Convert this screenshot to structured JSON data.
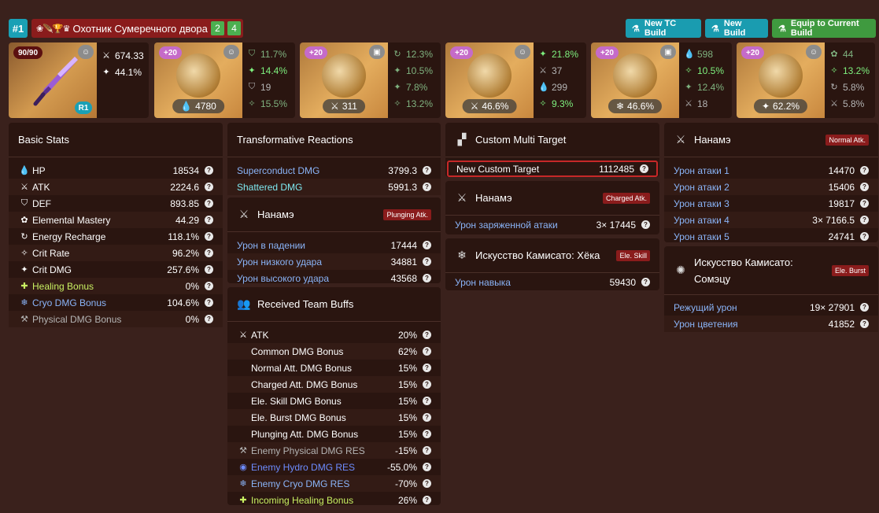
{
  "header": {
    "build_number": "#1",
    "set_name": "Охотник Сумеречного двора",
    "set_count_a": "2",
    "set_count_b": "4",
    "buttons": {
      "new_tc": "New TC Build",
      "new_build": "New Build",
      "equip": "Equip to Current Build"
    }
  },
  "weapon": {
    "level": "90/90",
    "refine": "R1",
    "stats": [
      {
        "icon": "atk-icon",
        "value": "674.33"
      },
      {
        "icon": "crit-dmg-icon",
        "value": "44.1%"
      }
    ]
  },
  "artifacts": [
    {
      "level": "+20",
      "main": "4780",
      "main_icon": "hp-icon",
      "subs": [
        {
          "icon": "def-icon",
          "value": "11.7%",
          "color": "g1"
        },
        {
          "icon": "crit-dmg-icon",
          "value": "14.4%",
          "color": "g2"
        },
        {
          "icon": "def-icon",
          "value": "19",
          "color": "gr"
        },
        {
          "icon": "crit-rate-icon",
          "value": "15.5%",
          "color": "g1"
        }
      ]
    },
    {
      "level": "+20",
      "main": "311",
      "main_icon": "atk-icon",
      "subs": [
        {
          "icon": "energy-icon",
          "value": "12.3%",
          "color": "g1"
        },
        {
          "icon": "crit-dmg-icon",
          "value": "10.5%",
          "color": "g1"
        },
        {
          "icon": "crit-dmg-icon",
          "value": "7.8%",
          "color": "g1"
        },
        {
          "icon": "crit-rate-icon",
          "value": "13.2%",
          "color": "g1"
        }
      ]
    },
    {
      "level": "+20",
      "main": "46.6%",
      "main_icon": "atk-icon",
      "subs": [
        {
          "icon": "crit-dmg-icon",
          "value": "21.8%",
          "color": "g2"
        },
        {
          "icon": "atk-icon",
          "value": "37",
          "color": "gr"
        },
        {
          "icon": "hp-icon",
          "value": "299",
          "color": "gr"
        },
        {
          "icon": "crit-rate-icon",
          "value": "9.3%",
          "color": "g2"
        }
      ]
    },
    {
      "level": "+20",
      "main": "46.6%",
      "main_icon": "cryo-icon",
      "subs": [
        {
          "icon": "hp-icon",
          "value": "598",
          "color": "g1"
        },
        {
          "icon": "crit-rate-icon",
          "value": "10.5%",
          "color": "g2"
        },
        {
          "icon": "crit-dmg-icon",
          "value": "12.4%",
          "color": "g1"
        },
        {
          "icon": "atk-icon",
          "value": "18",
          "color": "gr"
        }
      ]
    },
    {
      "level": "+20",
      "main": "62.2%",
      "main_icon": "crit-dmg-icon",
      "subs": [
        {
          "icon": "em-icon",
          "value": "44",
          "color": "g1"
        },
        {
          "icon": "crit-rate-icon",
          "value": "13.2%",
          "color": "g2"
        },
        {
          "icon": "energy-icon",
          "value": "5.8%",
          "color": "gr"
        },
        {
          "icon": "atk-icon",
          "value": "5.8%",
          "color": "gr"
        }
      ]
    }
  ],
  "basic_stats": {
    "title": "Basic Stats",
    "rows": [
      {
        "icon": "hp-icon",
        "label": "HP",
        "value": "18534",
        "cls": ""
      },
      {
        "icon": "atk-icon",
        "label": "ATK",
        "value": "2224.6",
        "cls": ""
      },
      {
        "icon": "def-icon",
        "label": "DEF",
        "value": "893.85",
        "cls": ""
      },
      {
        "icon": "em-icon",
        "label": "Elemental Mastery",
        "value": "44.29",
        "cls": ""
      },
      {
        "icon": "energy-icon",
        "label": "Energy Recharge",
        "value": "118.1%",
        "cls": ""
      },
      {
        "icon": "crit-rate-icon",
        "label": "Crit Rate",
        "value": "96.2%",
        "cls": ""
      },
      {
        "icon": "crit-dmg-icon",
        "label": "Crit DMG",
        "value": "257.6%",
        "cls": ""
      },
      {
        "icon": "heal-icon",
        "label": "Healing Bonus",
        "value": "0%",
        "cls": "heal"
      },
      {
        "icon": "cryo-icon",
        "label": "Cryo DMG Bonus",
        "value": "104.6%",
        "cls": "cryo"
      },
      {
        "icon": "physical-icon",
        "label": "Physical DMG Bonus",
        "value": "0%",
        "cls": "physical"
      }
    ]
  },
  "transformative": {
    "title": "Transformative Reactions",
    "rows": [
      {
        "label": "Superconduct DMG",
        "value": "3799.3",
        "cls": "cryo"
      },
      {
        "label": "Shattered DMG",
        "value": "5991.3",
        "cls": "cyan"
      }
    ]
  },
  "plunging": {
    "title": "Нанамэ",
    "tag": "Plunging Atk.",
    "rows": [
      {
        "label": "Урон в падении",
        "value": "17444"
      },
      {
        "label": "Урон низкого удара",
        "value": "34881"
      },
      {
        "label": "Урон высокого удара",
        "value": "43568"
      }
    ]
  },
  "team_buffs": {
    "title": "Received Team Buffs",
    "rows": [
      {
        "icon": "atk-icon",
        "label": "ATK",
        "value": "20%",
        "cls": ""
      },
      {
        "icon": "",
        "label": "Common DMG Bonus",
        "value": "62%",
        "cls": ""
      },
      {
        "icon": "",
        "label": "Normal Att. DMG Bonus",
        "value": "15%",
        "cls": ""
      },
      {
        "icon": "",
        "label": "Charged Att. DMG Bonus",
        "value": "15%",
        "cls": ""
      },
      {
        "icon": "",
        "label": "Ele. Skill DMG Bonus",
        "value": "15%",
        "cls": ""
      },
      {
        "icon": "",
        "label": "Ele. Burst DMG Bonus",
        "value": "15%",
        "cls": ""
      },
      {
        "icon": "",
        "label": "Plunging Att. DMG Bonus",
        "value": "15%",
        "cls": ""
      },
      {
        "icon": "physical-icon",
        "label": "Enemy Physical DMG RES",
        "value": "-15%",
        "cls": "physical"
      },
      {
        "icon": "hydro-icon",
        "label": "Enemy Hydro DMG RES",
        "value": "-55.0%",
        "cls": "hydro"
      },
      {
        "icon": "cryo-icon",
        "label": "Enemy Cryo DMG RES",
        "value": "-70%",
        "cls": "cryo"
      },
      {
        "icon": "heal-icon",
        "label": "Incoming Healing Bonus",
        "value": "26%",
        "cls": "heal"
      }
    ]
  },
  "multi_target": {
    "title": "Custom Multi Target",
    "row": {
      "label": "New Custom Target",
      "value": "1112485"
    }
  },
  "charged": {
    "title": "Нанамэ",
    "tag": "Charged Atk.",
    "row": {
      "label": "Урон заряженной атаки",
      "value": "3× 17445"
    }
  },
  "skill": {
    "title": "Искусство Камисато: Хёка",
    "tag": "Ele. Skill",
    "row": {
      "label": "Урон навыка",
      "value": "59430"
    }
  },
  "normal": {
    "title": "Нанамэ",
    "tag": "Normal Atk.",
    "rows": [
      {
        "label": "Урон атаки 1",
        "value": "14470"
      },
      {
        "label": "Урон атаки 2",
        "value": "15406"
      },
      {
        "label": "Урон атаки 3",
        "value": "19817"
      },
      {
        "label": "Урон атаки 4",
        "value": "3× 7166.5"
      },
      {
        "label": "Урон атаки 5",
        "value": "24741"
      }
    ]
  },
  "burst": {
    "title_line1": "Искусство Камисато:",
    "title_line2": "Сомэцу",
    "tag": "Ele. Burst",
    "rows": [
      {
        "label": "Режущий урон",
        "value": "19× 27901"
      },
      {
        "label": "Урон цветения",
        "value": "41852"
      }
    ]
  },
  "icon_glyphs": {
    "hp-icon": "💧",
    "atk-icon": "⚔",
    "def-icon": "⛉",
    "em-icon": "✿",
    "energy-icon": "↻",
    "crit-rate-icon": "✧",
    "crit-dmg-icon": "✦",
    "heal-icon": "✚",
    "cryo-icon": "❄",
    "physical-icon": "⚒",
    "hydro-icon": "◉"
  }
}
